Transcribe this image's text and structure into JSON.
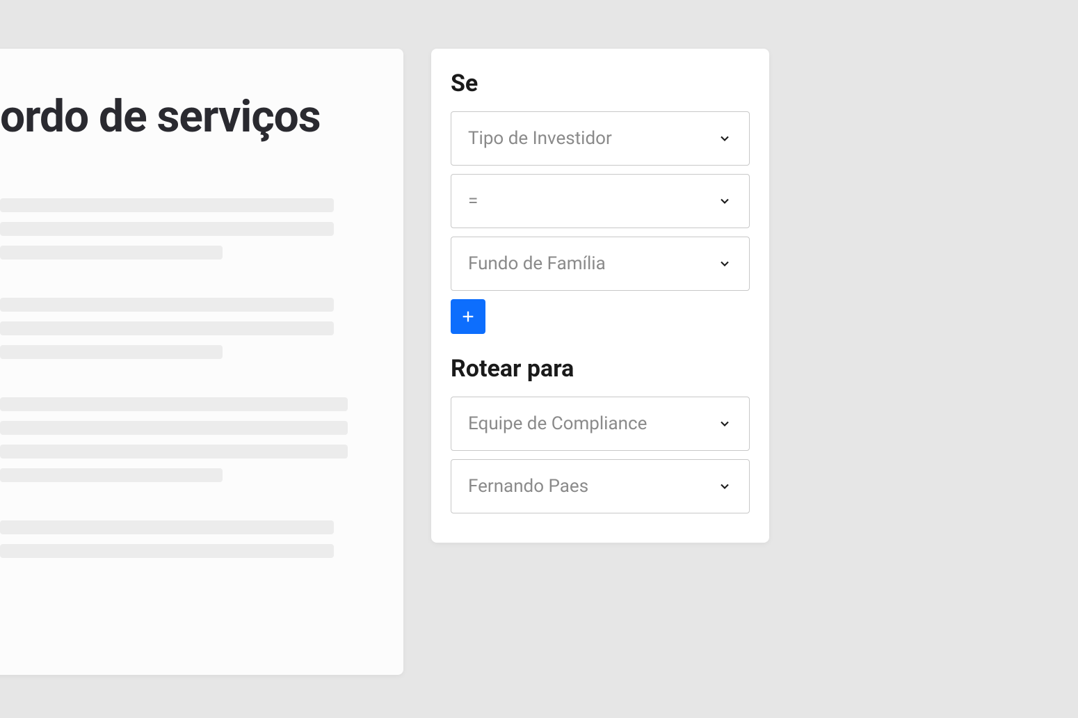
{
  "document": {
    "title": "ordo de serviços"
  },
  "rules": {
    "if_heading": "Se",
    "condition_field": "Tipo de Investidor",
    "condition_operator": "=",
    "condition_value": "Fundo de Família",
    "route_heading": "Rotear para",
    "route_team": "Equipe de Compliance",
    "route_person": "Fernando Paes"
  }
}
